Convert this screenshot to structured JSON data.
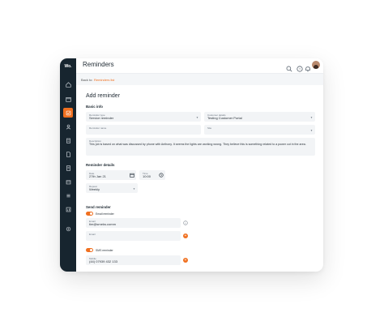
{
  "app": {
    "logo": "Wo.",
    "title": "Reminders"
  },
  "breadcrumb": {
    "prefix": "Back to:",
    "link": "Reminders list"
  },
  "form": {
    "title": "Add reminder",
    "basic_info": {
      "heading": "Basic info",
      "reminder_type": {
        "label": "Reminder type",
        "value": "Service reminder"
      },
      "customer_details": {
        "label": "Customer details",
        "value": "Testing Customer Portal"
      },
      "reminder_name": {
        "label": "Reminder name",
        "value": ""
      },
      "site": {
        "label": "Site",
        "value": ""
      },
      "description": {
        "label": "Description",
        "value": "This job is based on what was discussed by phone with Anthony. It seems the lights are working wrong. They believe this is something related to a power cut in the area."
      }
    },
    "reminder_details": {
      "heading": "Reminder details",
      "date": {
        "label": "Date",
        "value": "27th Jan 21"
      },
      "time": {
        "label": "Time",
        "value": "10:00"
      },
      "repeat": {
        "label": "Repeat",
        "value": "Weekly"
      }
    },
    "send_reminder": {
      "heading": "Send reminder",
      "email_toggle": {
        "label": "Email reminder",
        "on": true
      },
      "email_1": {
        "label": "Email",
        "value": "tim@smeks.comm"
      },
      "email_2": {
        "label": "Email",
        "value": ""
      },
      "sms_toggle": {
        "label": "SMS reminder",
        "on": true
      },
      "mobile": {
        "label": "Mobile",
        "value": "(44) 07939 432 133"
      }
    }
  },
  "icons": {
    "nav": [
      "home-icon",
      "calendar-icon",
      "reminders-icon",
      "users-icon",
      "clipboard-icon",
      "file-icon",
      "invoice-icon",
      "box-icon",
      "list-icon",
      "chart-icon",
      "settings-icon"
    ],
    "top": [
      "search-icon",
      "help-icon",
      "bell-icon"
    ]
  },
  "colors": {
    "sidebar": "#17252f",
    "accent": "#f07020"
  }
}
